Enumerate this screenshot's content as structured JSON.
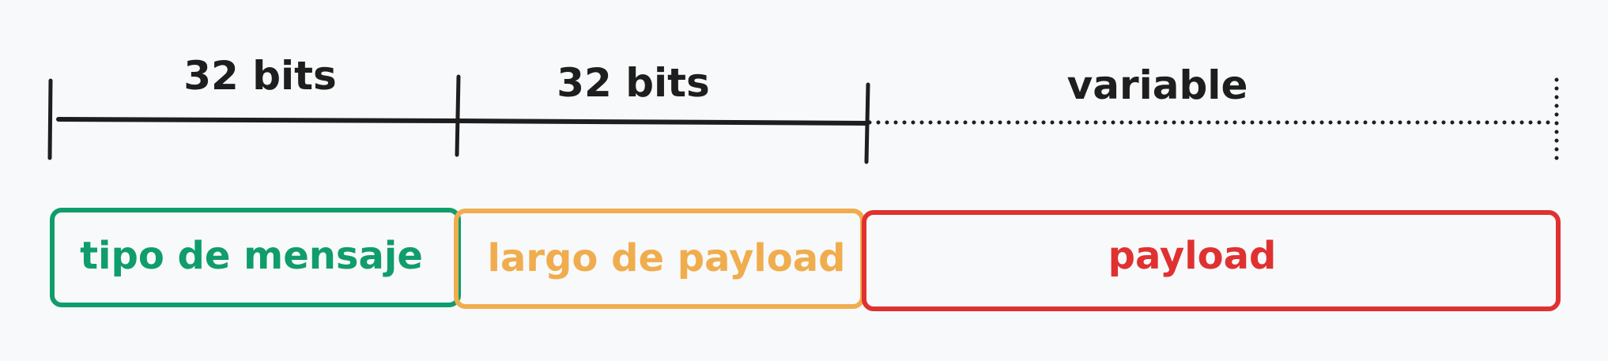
{
  "ruler": {
    "segments": [
      {
        "label": "32 bits"
      },
      {
        "label": "32 bits"
      },
      {
        "label": "variable"
      }
    ]
  },
  "fields": [
    {
      "label": "tipo de mensaje",
      "color": "#0f9d6b"
    },
    {
      "label": "largo de payload",
      "color": "#f0ad4e"
    },
    {
      "label": "payload",
      "color": "#e03131"
    }
  ]
}
